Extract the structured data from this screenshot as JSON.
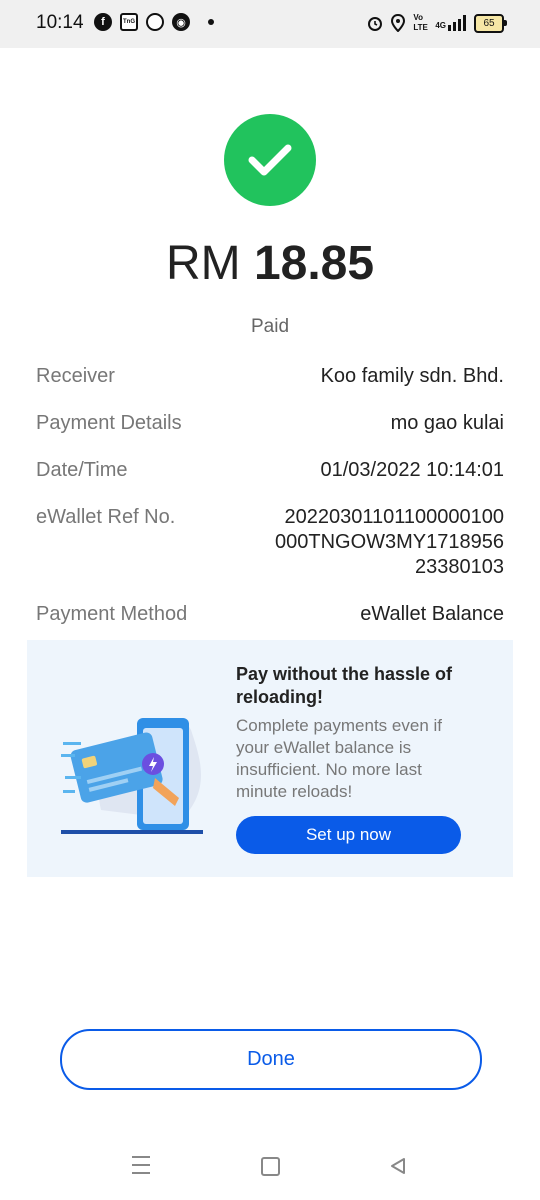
{
  "status_bar": {
    "time": "10:14",
    "network": "4G",
    "volte": "Vo LTE",
    "battery": "65"
  },
  "receipt": {
    "currency": "RM",
    "amount": "18.85",
    "status": "Paid",
    "rows": [
      {
        "label": "Receiver",
        "value": "Koo family sdn. Bhd."
      },
      {
        "label": "Payment Details",
        "value": "mo gao kulai"
      },
      {
        "label": "Date/Time",
        "value": "01/03/2022 10:14:01"
      },
      {
        "label": "eWallet Ref No.",
        "value": "20220301101100000100000TNGOW3MY171895623380103"
      },
      {
        "label": "Payment Method",
        "value": "eWallet Balance"
      }
    ]
  },
  "promo": {
    "title": "Pay without the hassle of reloading!",
    "description": "Complete payments even if your eWallet balance is insufficient. No more last minute reloads!",
    "button": "Set up now"
  },
  "done_button": "Done",
  "colors": {
    "success": "#21c35d",
    "primary": "#0a5be8",
    "promo_bg": "#eef5fc"
  }
}
